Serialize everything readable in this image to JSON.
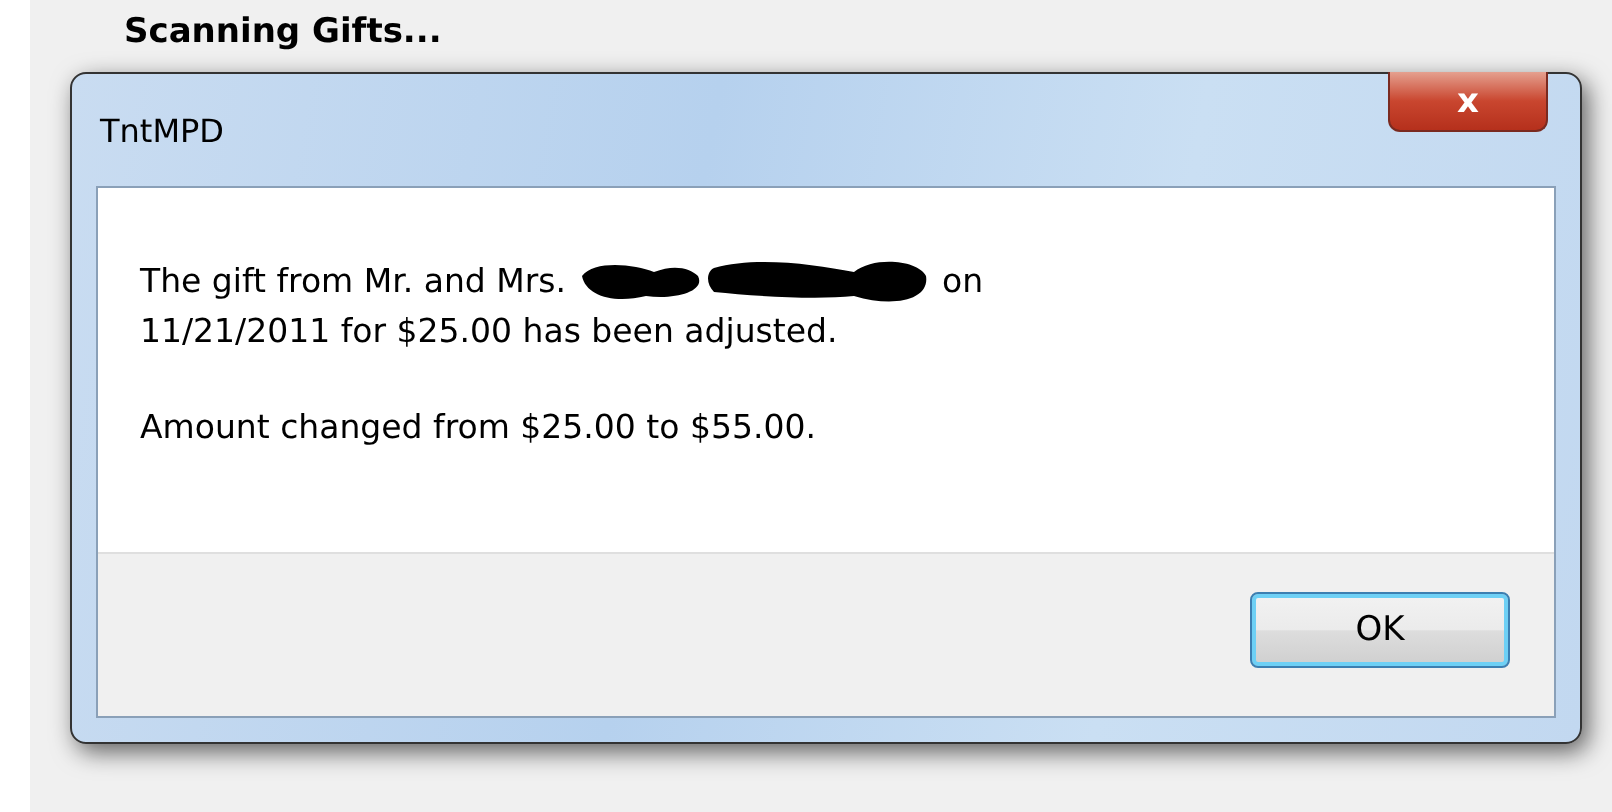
{
  "background_title": "Scanning Gifts...",
  "window": {
    "title": "TntMPD",
    "close_button": "x"
  },
  "message": {
    "line_1_before": "The gift from Mr. and Mrs.",
    "redacted": true,
    "line_1_after": "on",
    "line_2": "11/21/2011 for $25.00 has been adjusted.",
    "line_3": "Amount changed from $25.00 to $55.00."
  },
  "buttons": [
    {
      "label": "OK",
      "selected": true
    }
  ]
}
